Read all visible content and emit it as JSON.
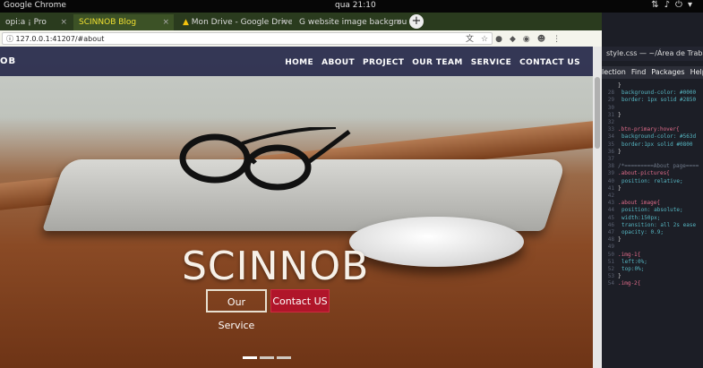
{
  "top_panel": {
    "app_name": "Google Chrome",
    "clock": "qua 21:10",
    "indicator_icons": [
      "network-icon",
      "volume-icon",
      "power-icon",
      "settings-icon"
    ]
  },
  "browser": {
    "tabs": [
      {
        "label": "opi:a ¡ Pro",
        "active": false
      },
      {
        "label": "SCINNOB Blog",
        "active": true
      },
      {
        "label": "Mon Drive - Google Drive",
        "active": false
      },
      {
        "label": "website image backgrou",
        "active": false
      }
    ],
    "new_tab_label": "+",
    "url": "127.0.0.1:41207/#about"
  },
  "site": {
    "brand": "OB",
    "nav": [
      "HOME",
      "ABOUT",
      "PROJECT",
      "OUR TEAM",
      "SERVICE",
      "CONTACT US"
    ],
    "headline": "SCINNOB",
    "buttons": {
      "service": "Our Service",
      "contact": "Contact US"
    },
    "slide_indicators": 3,
    "active_slide": 1,
    "accent": "#b0152a",
    "navbar_color": "#14163c"
  },
  "editor": {
    "title": "style.css — ~/Área de Trabalho",
    "menu": [
      "lection",
      "Find",
      "Packages",
      "Help"
    ],
    "lines": [
      {
        "n": "",
        "text": "}"
      },
      {
        "n": "28",
        "text": "background-color: #0000"
      },
      {
        "n": "29",
        "text": "border: 1px solid #2850"
      },
      {
        "n": "30",
        "text": ""
      },
      {
        "n": "31",
        "text": "}"
      },
      {
        "n": "32",
        "text": ""
      },
      {
        "n": "33",
        "text": ".btn-primary:hover{"
      },
      {
        "n": "34",
        "text": "background-color: #563d"
      },
      {
        "n": "35",
        "text": "border:1px solid #0800"
      },
      {
        "n": "36",
        "text": "}"
      },
      {
        "n": "37",
        "text": ""
      },
      {
        "n": "38",
        "text": "/*=========About page===="
      },
      {
        "n": "39",
        "text": ".about-pictures{"
      },
      {
        "n": "40",
        "text": "position: relative;"
      },
      {
        "n": "41",
        "text": "}"
      },
      {
        "n": "42",
        "text": ""
      },
      {
        "n": "43",
        "text": ".about image{"
      },
      {
        "n": "44",
        "text": "position: absolute;"
      },
      {
        "n": "45",
        "text": "width:150px;"
      },
      {
        "n": "46",
        "text": "transition: all 2s ease"
      },
      {
        "n": "47",
        "text": "opacity: 0.9;"
      },
      {
        "n": "48",
        "text": "}"
      },
      {
        "n": "49",
        "text": ""
      },
      {
        "n": "50",
        "text": ".img-1{"
      },
      {
        "n": "51",
        "text": "left:0%;"
      },
      {
        "n": "52",
        "text": "top:0%;"
      },
      {
        "n": "53",
        "text": "}"
      },
      {
        "n": "54",
        "text": ".img-2{"
      }
    ]
  }
}
